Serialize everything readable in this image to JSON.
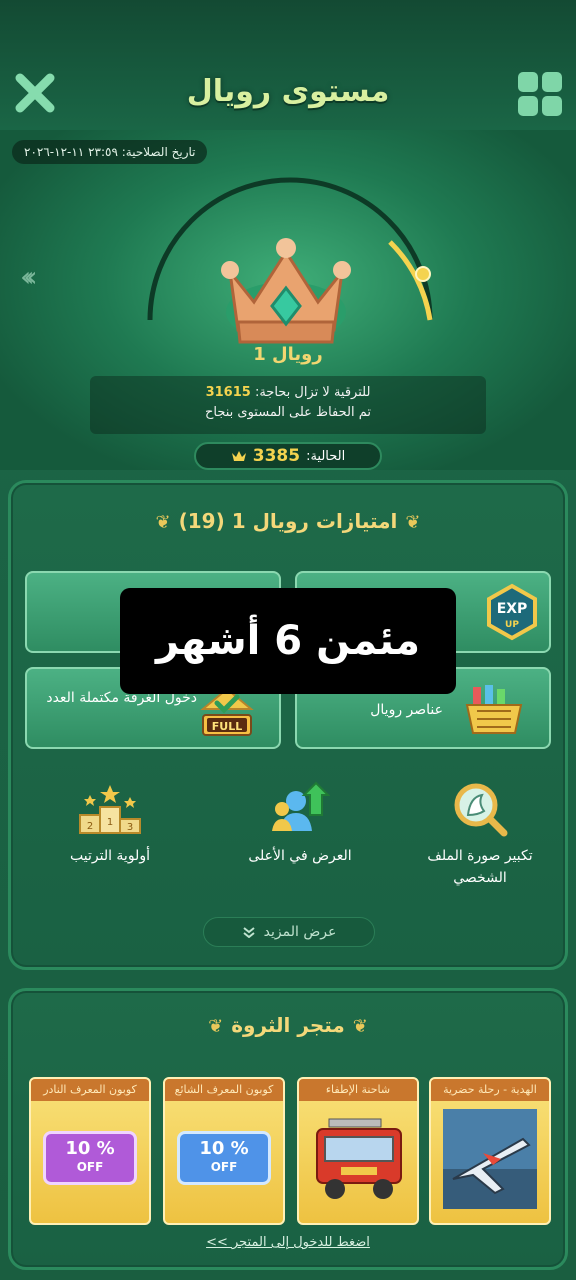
{
  "header": {
    "title": "مستوى رويال"
  },
  "hero": {
    "expiry": "تاريخ الصلاحية: ٢٣:٥٩ ١١-١٢-٢٠٢٦",
    "level_name": "رويال 1",
    "upgrade_prefix": "للترقية لا تزال بحاجة:",
    "upgrade_needed": "31615",
    "maintained_text": "تم الحفاظ على المستوى بنجاح",
    "current_label": "الحالية:",
    "current_value": "3385"
  },
  "privileges": {
    "title": "امتيازات رويال 1 (19)",
    "cards": [
      {
        "label": ""
      },
      {
        "label": ""
      },
      {
        "label": "دخول الغرفة مكتملة العدد",
        "badge": "FULL"
      },
      {
        "label": "عناصر رويال"
      }
    ],
    "exp_badge_top": "EXP",
    "exp_badge_bottom": "UP",
    "items": [
      {
        "label": "تكبير صورة الملف الشخصي",
        "icon": "magnify-profile-icon"
      },
      {
        "label": "العرض في الأعلى",
        "icon": "top-display-icon"
      },
      {
        "label": "أولوية الترتيب",
        "icon": "podium-icon"
      }
    ],
    "podium_numbers": [
      "2",
      "1",
      "3"
    ],
    "more_label": "عرض المزيد"
  },
  "overlay": {
    "text": "مئمن 6 أشهر"
  },
  "store": {
    "title": "متجر الثروة",
    "items": [
      {
        "label": "الهدية - رحلة حضرية"
      },
      {
        "label": "شاحنة الإطفاء"
      },
      {
        "label": "كوبون المعرف الشائع",
        "pct": "10 %",
        "off": "OFF"
      },
      {
        "label": "كوبون المعرف النادر",
        "pct": "10 %",
        "off": "OFF"
      }
    ],
    "link": "اضغط للدخول إلى المتجر >>"
  },
  "colors": {
    "accent_gold": "#f4d34f",
    "panel_green": "#1e6a49",
    "title_green": "#d8f0a0"
  }
}
